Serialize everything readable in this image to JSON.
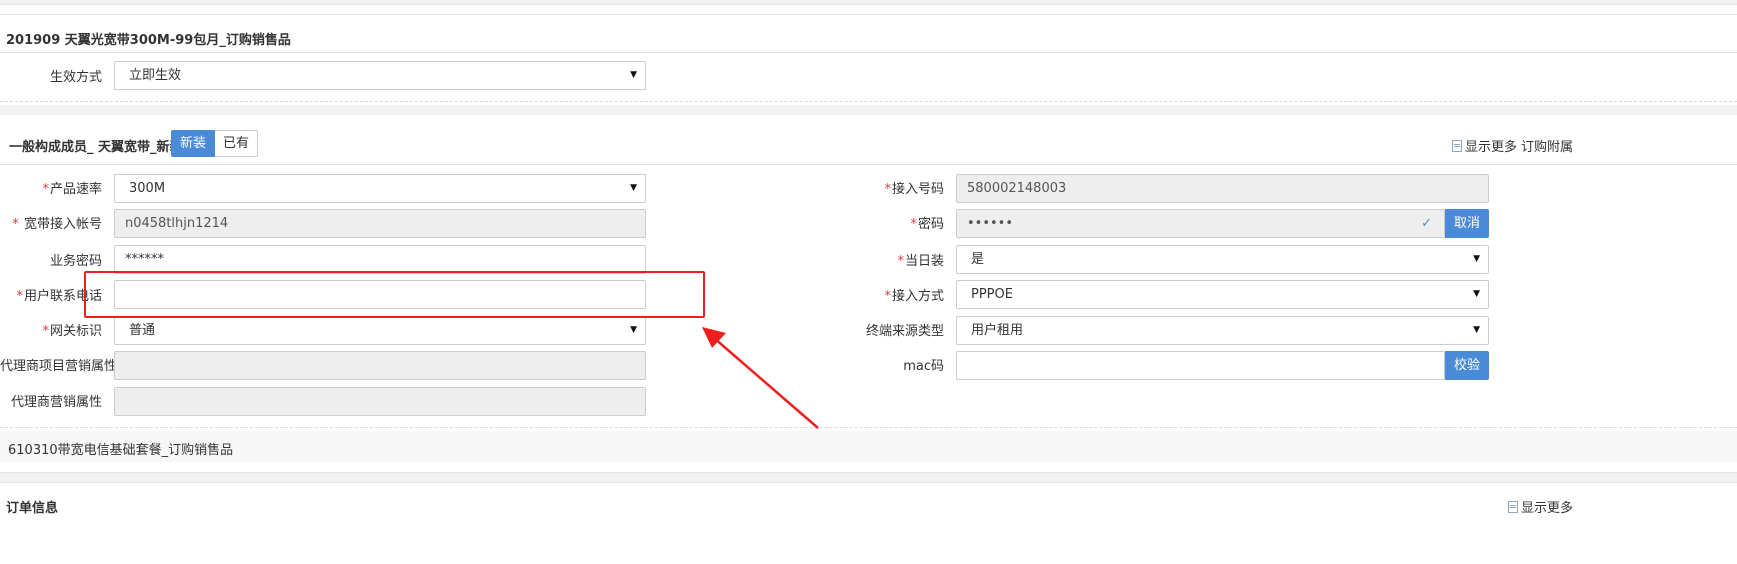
{
  "package_section": {
    "title": "201909 天翼光宽带300M-99包月_订购销售品",
    "effect_label": "生效方式",
    "effect_value": "立即生效"
  },
  "member_section": {
    "title": "一般构成成员_ 天翼宽带_新装",
    "toggle": {
      "new_label": "新装",
      "existing_label": "已有",
      "selected": "新装"
    },
    "show_more": "显示更多",
    "order_attach": "订购附属"
  },
  "left_fields": {
    "speed": {
      "label": "产品速率",
      "required": true,
      "value": "300M"
    },
    "account": {
      "label": "宽带接入帐号",
      "required": true,
      "value": "n0458tlhjn1214"
    },
    "service_password": {
      "label": "业务密码",
      "required": false,
      "value": "******"
    },
    "contact_phone": {
      "label": "用户联系电话",
      "required": true,
      "value": ""
    },
    "gateway": {
      "label": "网关标识",
      "required": true,
      "value": "普通"
    },
    "agent_project": {
      "label": "代理商项目营销属性",
      "required": false,
      "value": ""
    },
    "agent_marketing": {
      "label": "代理商营销属性",
      "required": false,
      "value": ""
    }
  },
  "right_fields": {
    "access_number": {
      "label": "接入号码",
      "required": true,
      "value": "580002148003"
    },
    "password": {
      "label": "密码",
      "required": true,
      "value": "••••••",
      "button": "取消",
      "verified_icon": "check-icon"
    },
    "same_day": {
      "label": "当日装",
      "required": true,
      "value": "是"
    },
    "access_mode": {
      "label": "接入方式",
      "required": true,
      "value": "PPPOE"
    },
    "terminal_source": {
      "label": "终端来源类型",
      "required": false,
      "value": "用户租用"
    },
    "mac": {
      "label": "mac码",
      "required": false,
      "value": "",
      "button": "校验"
    }
  },
  "base_package": {
    "title": "610310带宽电信基础套餐_订购销售品"
  },
  "order_section": {
    "title": "订单信息",
    "show_more": "显示更多"
  },
  "colors": {
    "accent": "#4a8bd7",
    "required": "#e4393c",
    "annotation": "#ee1f1f"
  }
}
